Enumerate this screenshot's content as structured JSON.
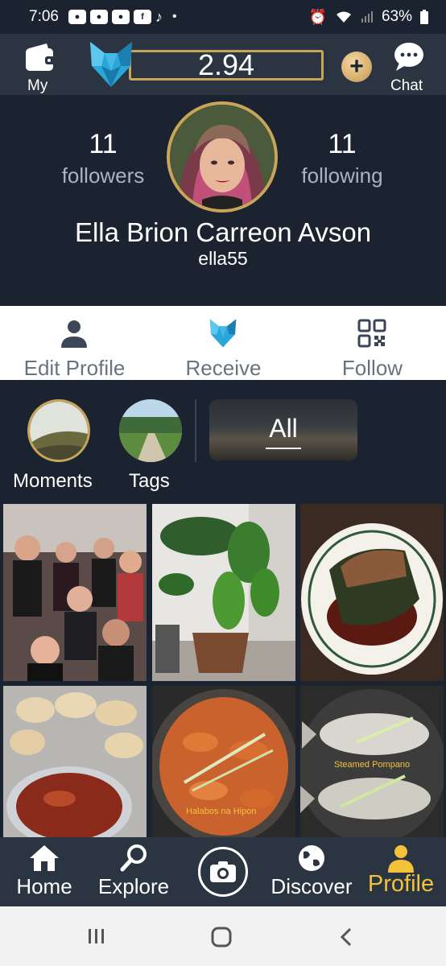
{
  "status_bar": {
    "time": "7:06",
    "battery": "63%"
  },
  "header": {
    "wallet_label": "My",
    "balance": "2.94",
    "chat_label": "Chat"
  },
  "profile": {
    "followers_count": "11",
    "followers_label": "followers",
    "following_count": "11",
    "following_label": "following",
    "name": "Ella Brion Carreon Avson",
    "username": "ella55"
  },
  "actions": [
    {
      "label": "Edit Profile",
      "icon": "person-icon"
    },
    {
      "label": "Receive",
      "icon": "cat-logo-icon"
    },
    {
      "label": "Follow",
      "icon": "qr-code-icon"
    }
  ],
  "albums": {
    "moments_label": "Moments",
    "tags_label": "Tags",
    "all_label": "All"
  },
  "photos": [
    {
      "caption": ""
    },
    {
      "caption": ""
    },
    {
      "caption": ""
    },
    {
      "caption": ""
    },
    {
      "caption": "Halabos na Hipon"
    },
    {
      "caption": "Steamed Pompano"
    }
  ],
  "bottom_nav": [
    {
      "label": "Home",
      "icon": "home-icon"
    },
    {
      "label": "Explore",
      "icon": "search-icon"
    },
    {
      "label": "",
      "icon": "camera-icon"
    },
    {
      "label": "Discover",
      "icon": "globe-icon"
    },
    {
      "label": "Profile",
      "icon": "person-icon",
      "active": true
    }
  ],
  "colors": {
    "accent_gold": "#c9a55a",
    "active_nav": "#f3c13a",
    "background": "#1b2330",
    "header": "#2b3542"
  }
}
